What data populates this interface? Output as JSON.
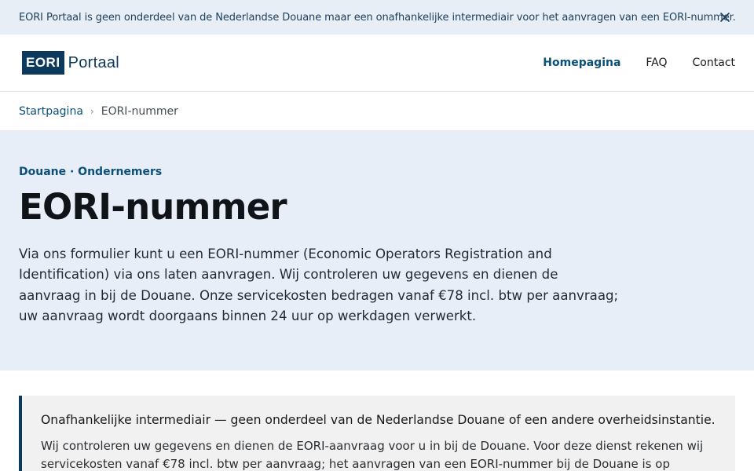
{
  "banner": {
    "text": "EORI Portaal is geen onderdeel van de Nederlandse Douane maar een onafhankelijke intermediair voor het aanvragen van een EORI-nummer.",
    "close_icon": "close-icon"
  },
  "header": {
    "logo_box": "EORI",
    "logo_text": "Portaal",
    "nav": [
      {
        "label": "Homepagina",
        "active": true
      },
      {
        "label": "FAQ",
        "active": false
      },
      {
        "label": "Contact",
        "active": false
      }
    ]
  },
  "breadcrumb": {
    "home": "Startpagina",
    "separator": "›",
    "current": "EORI-nummer"
  },
  "hero": {
    "eyebrow": "Douane · Ondernemers",
    "title": "EORI-nummer",
    "intro": "Via ons formulier kunt u een EORI-nummer (Economic Operators Registration and Identification) via ons laten aanvragen. Wij controleren uw gegevens en dienen de aanvraag in bij de Douane. Onze servicekosten bedragen vanaf €78 incl. btw per aanvraag; uw aanvraag wordt doorgaans binnen 24 uur op werkdagen verwerkt."
  },
  "notice": {
    "title": "Onafhankelijke intermediair — geen onderdeel van de Nederlandse Douane of een andere overheidsinstantie.",
    "body": "Wij controleren uw gegevens en dienen de EORI-aanvraag voor u in bij de Douane. Voor deze dienst rekenen wij servicekosten vanaf €78 incl. btw per aanvraag; het aanvragen van een EORI-nummer bij de Douane is op zichzelf"
  },
  "colors": {
    "brand": "#0b3a5c",
    "link": "#0b4f7a",
    "hero_bg": "#e8eef7",
    "banner_bg": "#e8eef5"
  }
}
